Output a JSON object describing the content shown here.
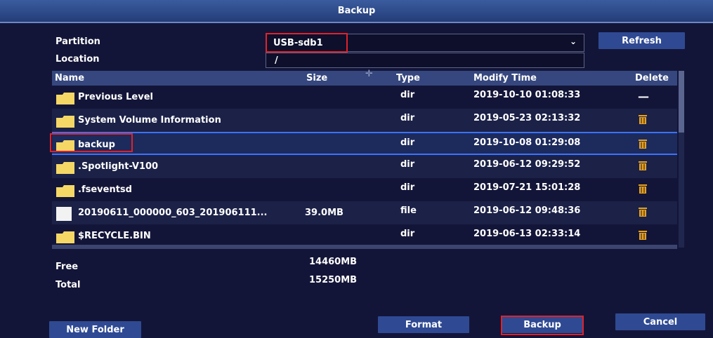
{
  "window": {
    "title": "Backup"
  },
  "form": {
    "partition_label": "Partition",
    "partition_value": "USB-sdb1",
    "location_label": "Location",
    "location_value": "/",
    "refresh_label": "Refresh"
  },
  "table": {
    "columns": [
      "Name",
      "Size",
      "Type",
      "Modify Time",
      "Delete"
    ],
    "rows": [
      {
        "name": "Previous Level",
        "size": "",
        "type": "dir",
        "time": "2019-10-10 01:08:33",
        "icon": "folder-icon",
        "delete": "dash"
      },
      {
        "name": "System Volume Information",
        "size": "",
        "type": "dir",
        "time": "2019-05-23 02:13:32",
        "icon": "folder-icon",
        "delete": "trash-icon"
      },
      {
        "name": "backup",
        "size": "",
        "type": "dir",
        "time": "2019-10-08 01:29:08",
        "icon": "folder-icon",
        "delete": "trash-icon"
      },
      {
        "name": ".Spotlight-V100",
        "size": "",
        "type": "dir",
        "time": "2019-06-12 09:29:52",
        "icon": "folder-icon",
        "delete": "trash-icon"
      },
      {
        "name": ".fseventsd",
        "size": "",
        "type": "dir",
        "time": "2019-07-21 15:01:28",
        "icon": "folder-icon",
        "delete": "trash-icon"
      },
      {
        "name": "20190611_000000_603_201906111...",
        "size": "39.0MB",
        "type": "file",
        "time": "2019-06-12 09:48:36",
        "icon": "file-icon",
        "delete": "trash-icon"
      },
      {
        "name": "$RECYCLE.BIN",
        "size": "",
        "type": "dir",
        "time": "2019-06-13 02:33:14",
        "icon": "folder-icon",
        "delete": "trash-icon"
      }
    ],
    "selected_index": 2
  },
  "storage": {
    "free_label": "Free",
    "free_value": "14460MB",
    "total_label": "Total",
    "total_value": "15250MB"
  },
  "buttons": {
    "new_folder": "New Folder",
    "format": "Format",
    "backup": "Backup",
    "cancel": "Cancel"
  },
  "colors": {
    "background": "#131538",
    "button": "#2f4a93",
    "folder": "#f5d766",
    "trash": "#e8a21c",
    "highlight": "#e0222a",
    "selection": "#3a73ff"
  }
}
